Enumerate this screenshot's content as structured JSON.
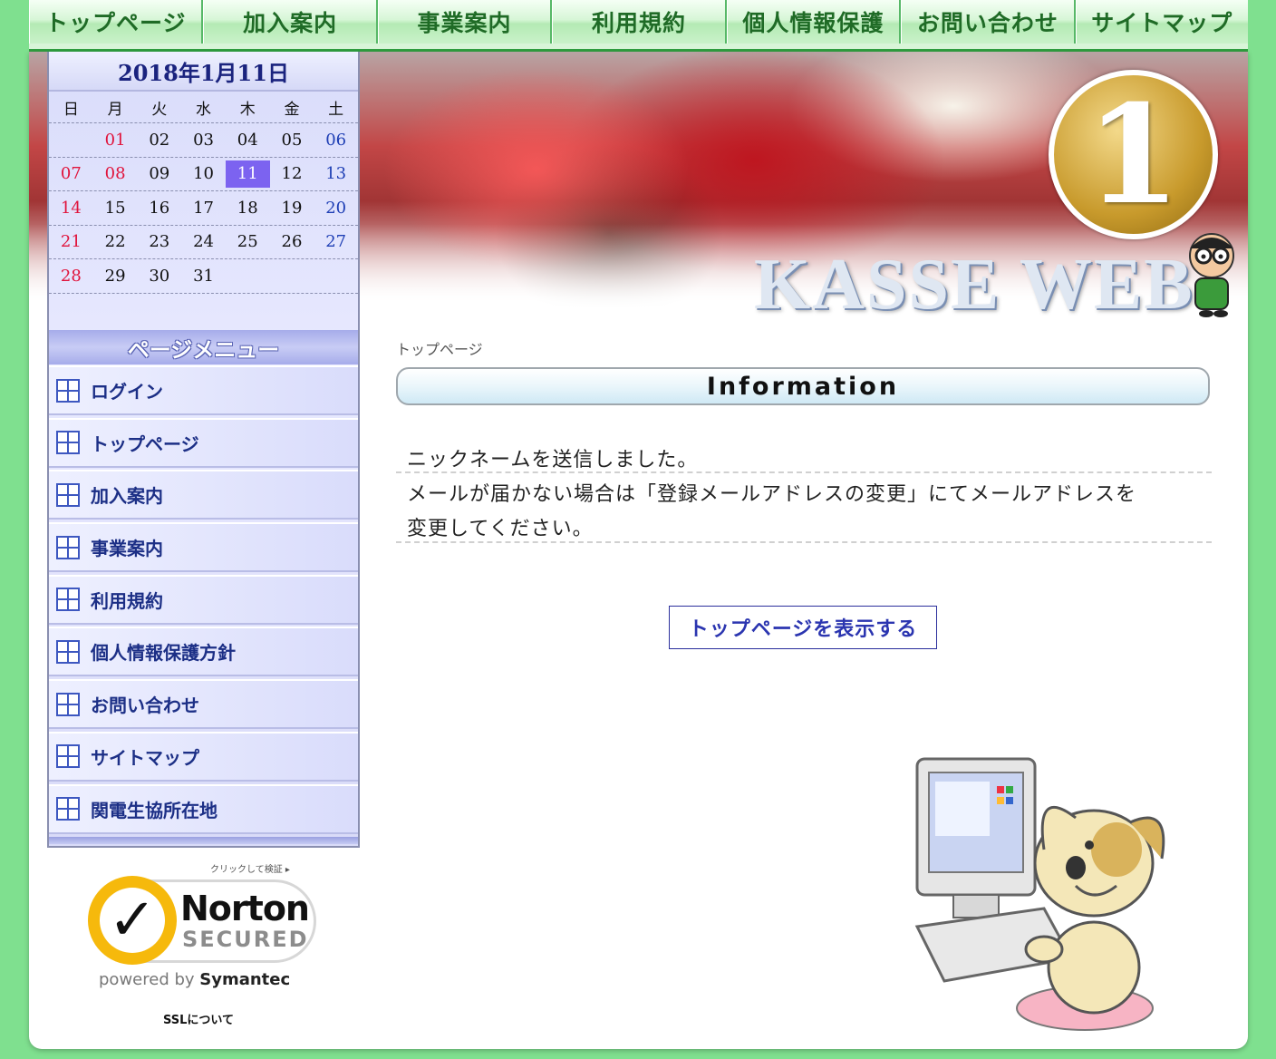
{
  "nav": {
    "items": [
      "トップページ",
      "加入案内",
      "事業案内",
      "利用規約",
      "個人情報保護",
      "お問い合わせ",
      "サイトマップ"
    ]
  },
  "banner": {
    "badge_number": "1",
    "logo_text": "KASSE WEB"
  },
  "calendar": {
    "title": "2018年1月11日",
    "weekdays": [
      "日",
      "月",
      "火",
      "水",
      "木",
      "金",
      "土"
    ],
    "weeks": [
      [
        "",
        "01",
        "02",
        "03",
        "04",
        "05",
        "06"
      ],
      [
        "07",
        "08",
        "09",
        "10",
        "11",
        "12",
        "13"
      ],
      [
        "14",
        "15",
        "16",
        "17",
        "18",
        "19",
        "20"
      ],
      [
        "21",
        "22",
        "23",
        "24",
        "25",
        "26",
        "27"
      ],
      [
        "28",
        "29",
        "30",
        "31",
        "",
        "",
        ""
      ]
    ],
    "holidays": [
      "01",
      "08"
    ],
    "today": "11"
  },
  "sidebar": {
    "menu_title": "ページメニュー",
    "items": [
      "ログイン",
      "トップページ",
      "加入案内",
      "事業案内",
      "利用規約",
      "個人情報保護方針",
      "お問い合わせ",
      "サイトマップ",
      "関電生協所在地"
    ]
  },
  "norton": {
    "click_text": "クリックして検証 ▸",
    "name": "Norton",
    "secured": "SECURED",
    "powered_prefix": "powered by ",
    "powered_brand": "Symantec",
    "ssl_link": "SSLについて"
  },
  "main": {
    "breadcrumb": "トップページ",
    "heading": "Information",
    "message_line1": "ニックネームを送信しました。",
    "message_line2": "メールが届かない場合は「登録メールアドレスの変更」にてメールアドレスを",
    "message_line3": "変更してください。",
    "button_label": "トップページを表示する"
  },
  "colors": {
    "background": "#7fe08f",
    "nav_text": "#1f6b26",
    "menu_text": "#1c2f86",
    "today_bg": "#7c63f0",
    "sunday": "#e0143c",
    "saturday": "#1f3fb5",
    "button_text": "#2b35b0"
  }
}
